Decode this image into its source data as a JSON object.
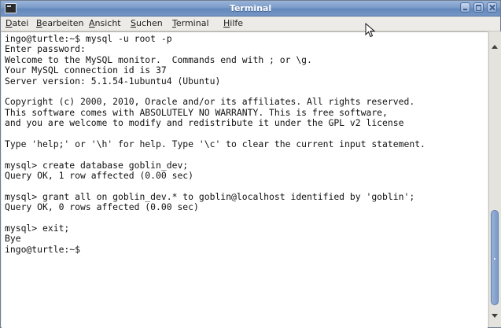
{
  "window": {
    "title": "Terminal"
  },
  "menu": {
    "items": [
      {
        "label": "Datei",
        "mnemonic": "D"
      },
      {
        "label": "Bearbeiten",
        "mnemonic": "B"
      },
      {
        "label": "Ansicht",
        "mnemonic": "A"
      },
      {
        "label": "Suchen",
        "mnemonic": "S"
      },
      {
        "label": "Terminal",
        "mnemonic": "T"
      },
      {
        "label": "Hilfe",
        "mnemonic": "H"
      }
    ]
  },
  "terminal": {
    "lines": [
      "ingo@turtle:~$ mysql -u root -p",
      "Enter password:",
      "Welcome to the MySQL monitor.  Commands end with ; or \\g.",
      "Your MySQL connection id is 37",
      "Server version: 5.1.54-1ubuntu4 (Ubuntu)",
      "",
      "Copyright (c) 2000, 2010, Oracle and/or its affiliates. All rights reserved.",
      "This software comes with ABSOLUTELY NO WARRANTY. This is free software,",
      "and you are welcome to modify and redistribute it under the GPL v2 license",
      "",
      "Type 'help;' or '\\h' for help. Type '\\c' to clear the current input statement.",
      "",
      "mysql> create database goblin_dev;",
      "Query OK, 1 row affected (0.00 sec)",
      "",
      "mysql> grant all on goblin_dev.* to goblin@localhost identified by 'goblin';",
      "Query OK, 0 rows affected (0.00 sec)",
      "",
      "mysql> exit;",
      "Bye",
      "ingo@turtle:~$"
    ]
  },
  "scrollbar": {
    "position_fraction": 0.97,
    "visible_fraction": 0.37
  },
  "icons": {
    "app": "terminal-icon",
    "minimize": "minimize-icon",
    "maximize": "maximize-icon",
    "close": "close-icon",
    "cursor": "mouse-pointer-icon"
  },
  "colors": {
    "titlebar": "#7b9cc9",
    "terminal_bg": "#ffffff",
    "terminal_fg": "#111111",
    "scroll_thumb": "#7b9ac8"
  }
}
